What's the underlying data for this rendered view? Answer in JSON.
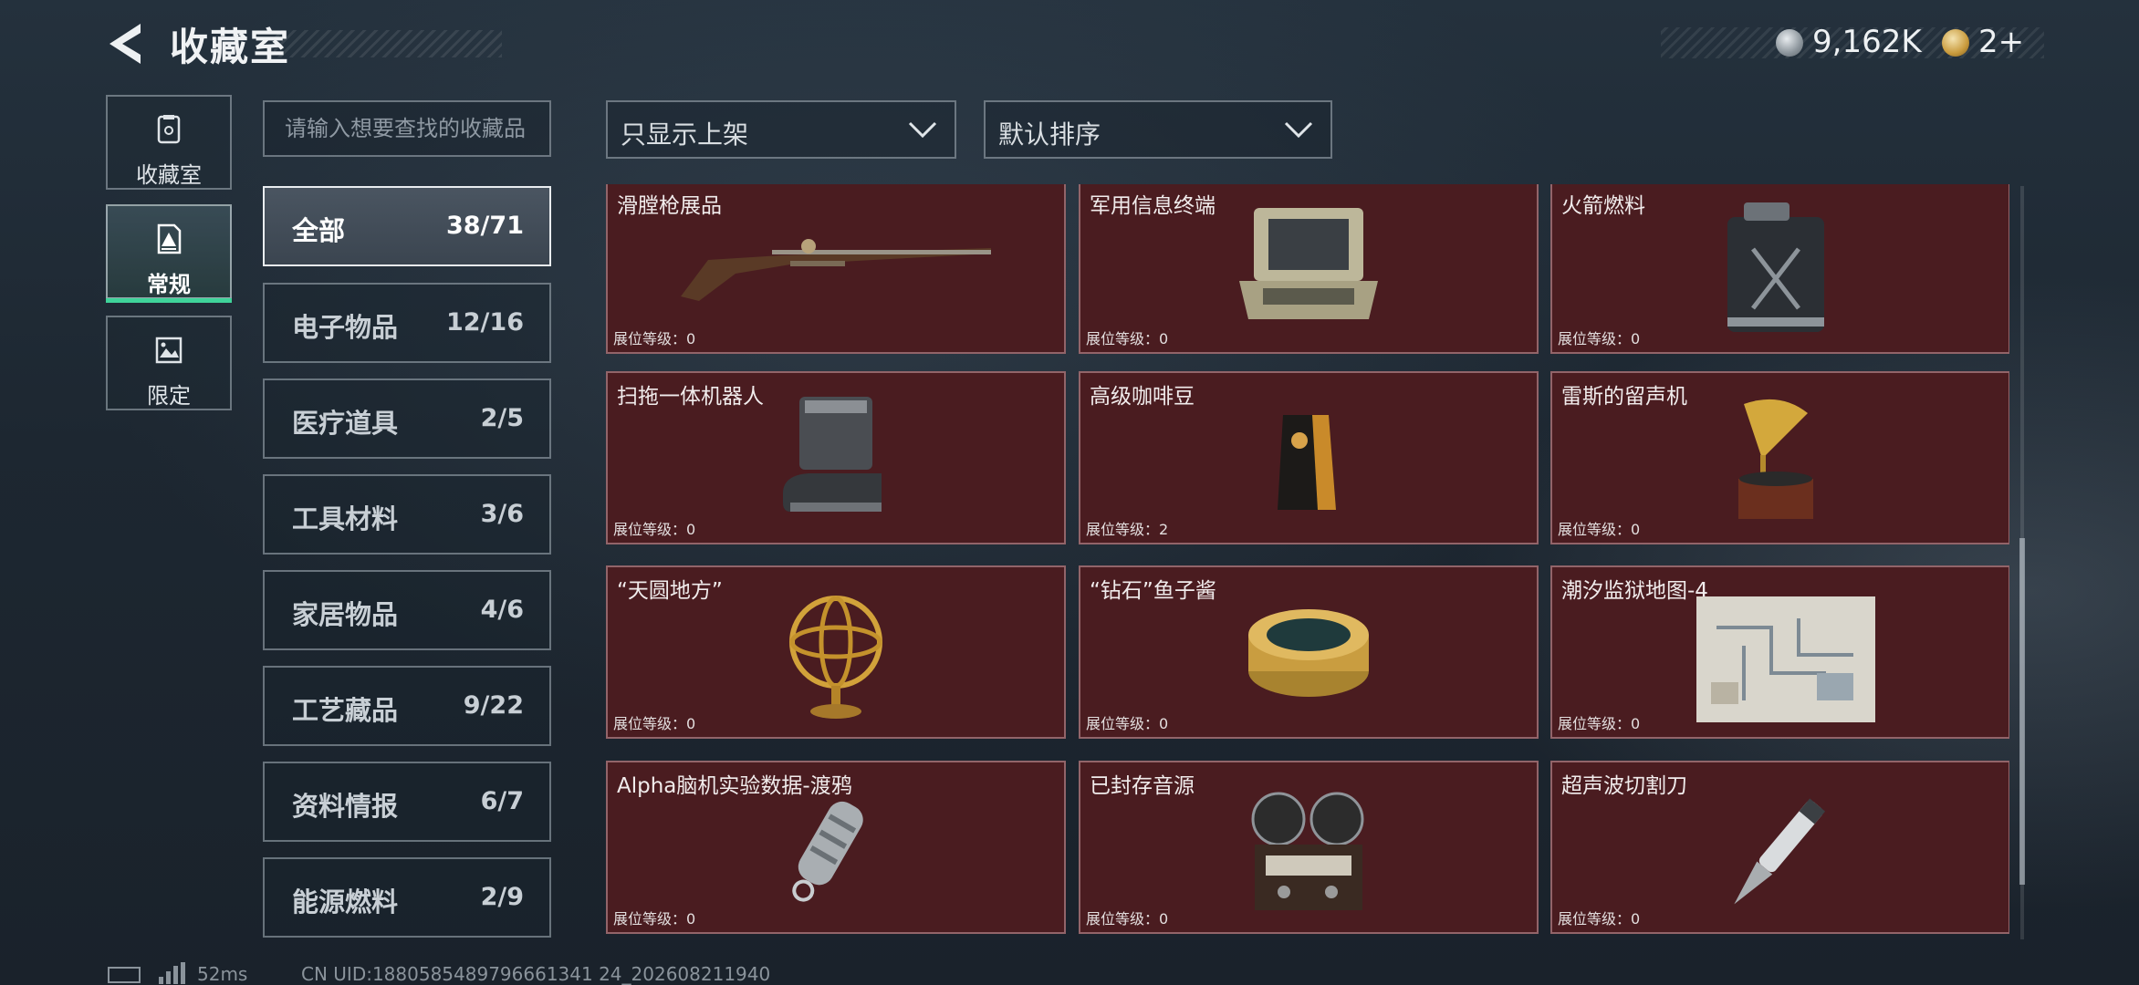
{
  "header": {
    "title": "收藏室",
    "coins": "9,162K",
    "tokens": "2+"
  },
  "side_tabs": [
    {
      "label": "收藏室",
      "icon": "vault-icon"
    },
    {
      "label": "常规",
      "icon": "warning-doc-icon",
      "active": true
    },
    {
      "label": "限定",
      "icon": "limited-icon"
    }
  ],
  "search": {
    "placeholder": "请输入想要查找的收藏品"
  },
  "filter": {
    "selected": "只显示上架"
  },
  "sort": {
    "selected": "默认排序"
  },
  "categories": [
    {
      "name": "全部",
      "count": "38/71",
      "active": true
    },
    {
      "name": "电子物品",
      "count": "12/16"
    },
    {
      "name": "医疗道具",
      "count": "2/5"
    },
    {
      "name": "工具材料",
      "count": "3/6"
    },
    {
      "name": "家居物品",
      "count": "4/6"
    },
    {
      "name": "工艺藏品",
      "count": "9/22"
    },
    {
      "name": "资料情报",
      "count": "6/7"
    },
    {
      "name": "能源燃料",
      "count": "2/9"
    }
  ],
  "level_prefix": "展位等级：",
  "items": [
    {
      "name": "滑膛枪展品",
      "level": "展位等级：0",
      "icon": "musket-icon"
    },
    {
      "name": "军用信息终端",
      "level": "展位等级：0",
      "icon": "rugged-terminal-icon"
    },
    {
      "name": "火箭燃料",
      "level": "展位等级：0",
      "icon": "fuel-canister-icon"
    },
    {
      "name": "扫拖一体机器人",
      "level": "展位等级：0",
      "icon": "robot-vacuum-icon"
    },
    {
      "name": "高级咖啡豆",
      "level": "展位等级：2",
      "icon": "coffee-bag-icon"
    },
    {
      "name": "雷斯的留声机",
      "level": "展位等级：0",
      "icon": "gramophone-icon"
    },
    {
      "name": "“天圆地方”",
      "level": "展位等级：0",
      "icon": "armillary-sphere-icon"
    },
    {
      "name": "“钻石”鱼子酱",
      "level": "展位等级：0",
      "icon": "caviar-tin-icon"
    },
    {
      "name": "潮汐监狱地图-4",
      "level": "展位等级：0",
      "icon": "prison-map-icon"
    },
    {
      "name": "Alpha脑机实验数据-渡鸦",
      "level": "展位等级：0",
      "icon": "data-capsule-icon"
    },
    {
      "name": "已封存音源",
      "level": "展位等级：0",
      "icon": "reel-recorder-icon"
    },
    {
      "name": "超声波切割刀",
      "level": "展位等级：0",
      "icon": "ultrasonic-cutter-icon"
    }
  ],
  "footer": {
    "ping": "52ms",
    "uid": "CN UID:1880585489796661341 24_202608211940"
  },
  "colors": {
    "card_bg": "#4a1c20",
    "active_underline": "#3fd39a",
    "background": "#1d2731"
  }
}
